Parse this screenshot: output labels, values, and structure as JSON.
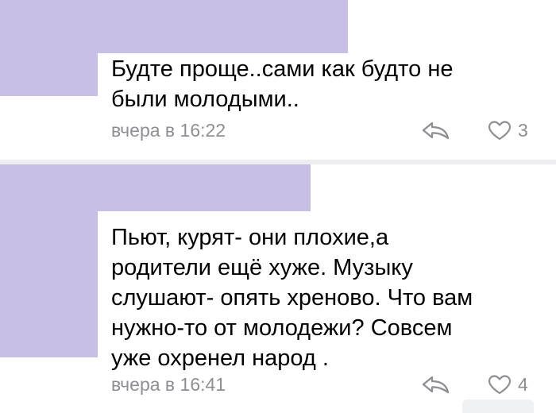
{
  "comments": [
    {
      "text": "Будте проще..сами как будто не\nбыли молодыми..",
      "timestamp": "вчера в 16:22",
      "likes": "3"
    },
    {
      "text": "Пьют, курят- они плохие,а\nродители ещё хуже. Музыку\nслушают- опять хреново. Что вам\nнужно-то от молодежи? Совсем\nуже охренел народ .",
      "timestamp": "вчера в 16:41",
      "likes": "4"
    }
  ],
  "colors": {
    "redaction": "#c7bfe6",
    "meta_text": "#8d8f94",
    "separator": "#eeeef0"
  },
  "icons": {
    "reply": "reply-arrow-icon",
    "like": "heart-outline-icon"
  }
}
